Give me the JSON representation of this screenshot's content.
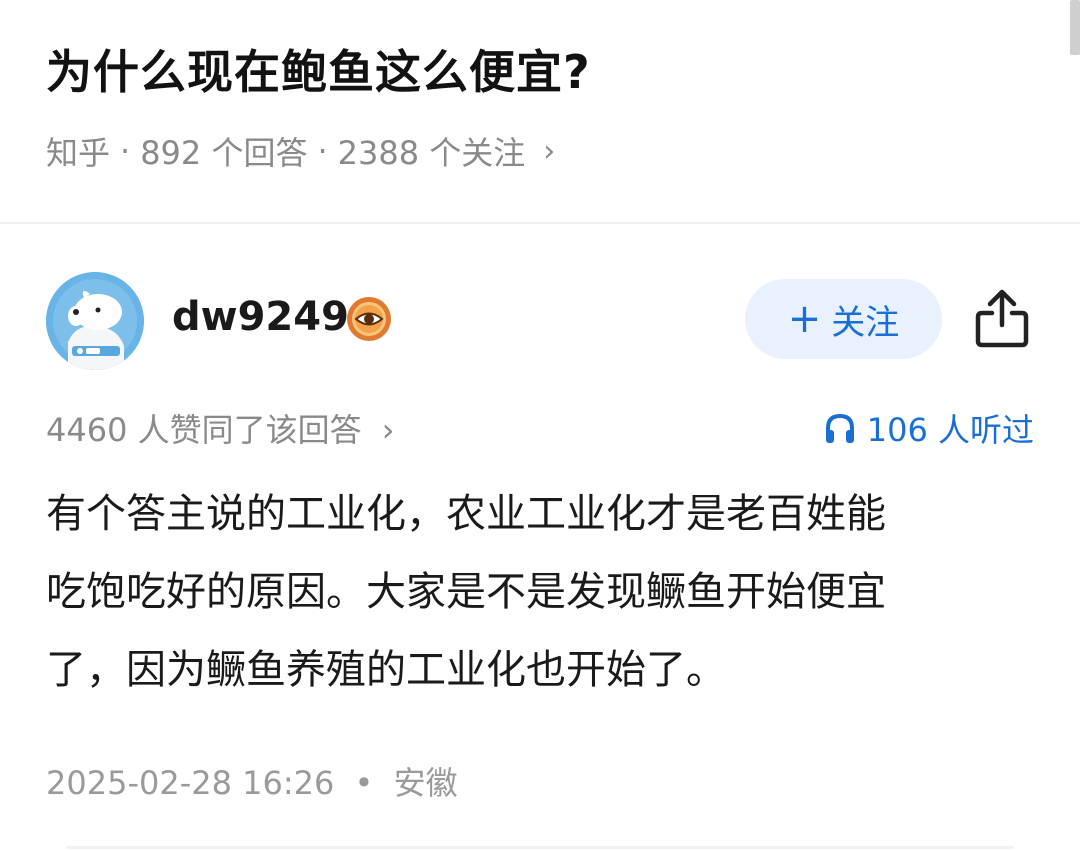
{
  "question": {
    "title": "为什么现在鲍鱼这么便宜?",
    "source": "知乎",
    "answers": "892 个回答",
    "followers": "2388 个关注",
    "meta_chevron": "›"
  },
  "answer": {
    "author": "dw9249",
    "follow_label": "关注",
    "follow_plus": "+",
    "votes": "4460 人赞同了该回答",
    "votes_chevron": "›",
    "listens": "106 人听过",
    "content_lines": [
      "有个答主说的工业化，农业工业化才是老百姓能",
      "吃饱吃好的原因。大家是不是发现鳜鱼开始便宜",
      "了，因为鳜鱼养殖的工业化也开始了。"
    ],
    "date": "2025-02-28 16:26",
    "location": "安徽",
    "dot": "•"
  },
  "colors": {
    "accent": "#1a6fd6",
    "follow_bg": "#e8f1fd",
    "meta_gray": "#8a8a8a"
  },
  "icons": {
    "badge": "eye-badge-icon",
    "share": "share-icon",
    "headphone": "headphone-icon"
  }
}
